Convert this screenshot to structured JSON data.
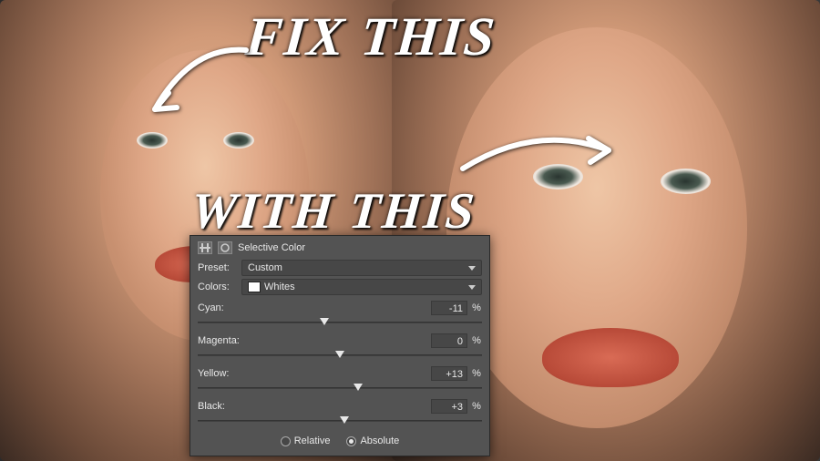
{
  "overlay": {
    "fix_this": "FIX THIS",
    "with_this": "WITH THIS"
  },
  "panel": {
    "title": "Selective Color",
    "preset_label": "Preset:",
    "preset_value": "Custom",
    "colors_label": "Colors:",
    "colors_value": "Whites",
    "swatch_color": "#ffffff",
    "sliders": {
      "cyan": {
        "label": "Cyan:",
        "value": "-11",
        "percent": "%"
      },
      "magenta": {
        "label": "Magenta:",
        "value": "0",
        "percent": "%"
      },
      "yellow": {
        "label": "Yellow:",
        "value": "+13",
        "percent": "%"
      },
      "black": {
        "label": "Black:",
        "value": "+3",
        "percent": "%"
      }
    },
    "mode": {
      "relative": "Relative",
      "absolute": "Absolute",
      "selected": "absolute"
    }
  }
}
